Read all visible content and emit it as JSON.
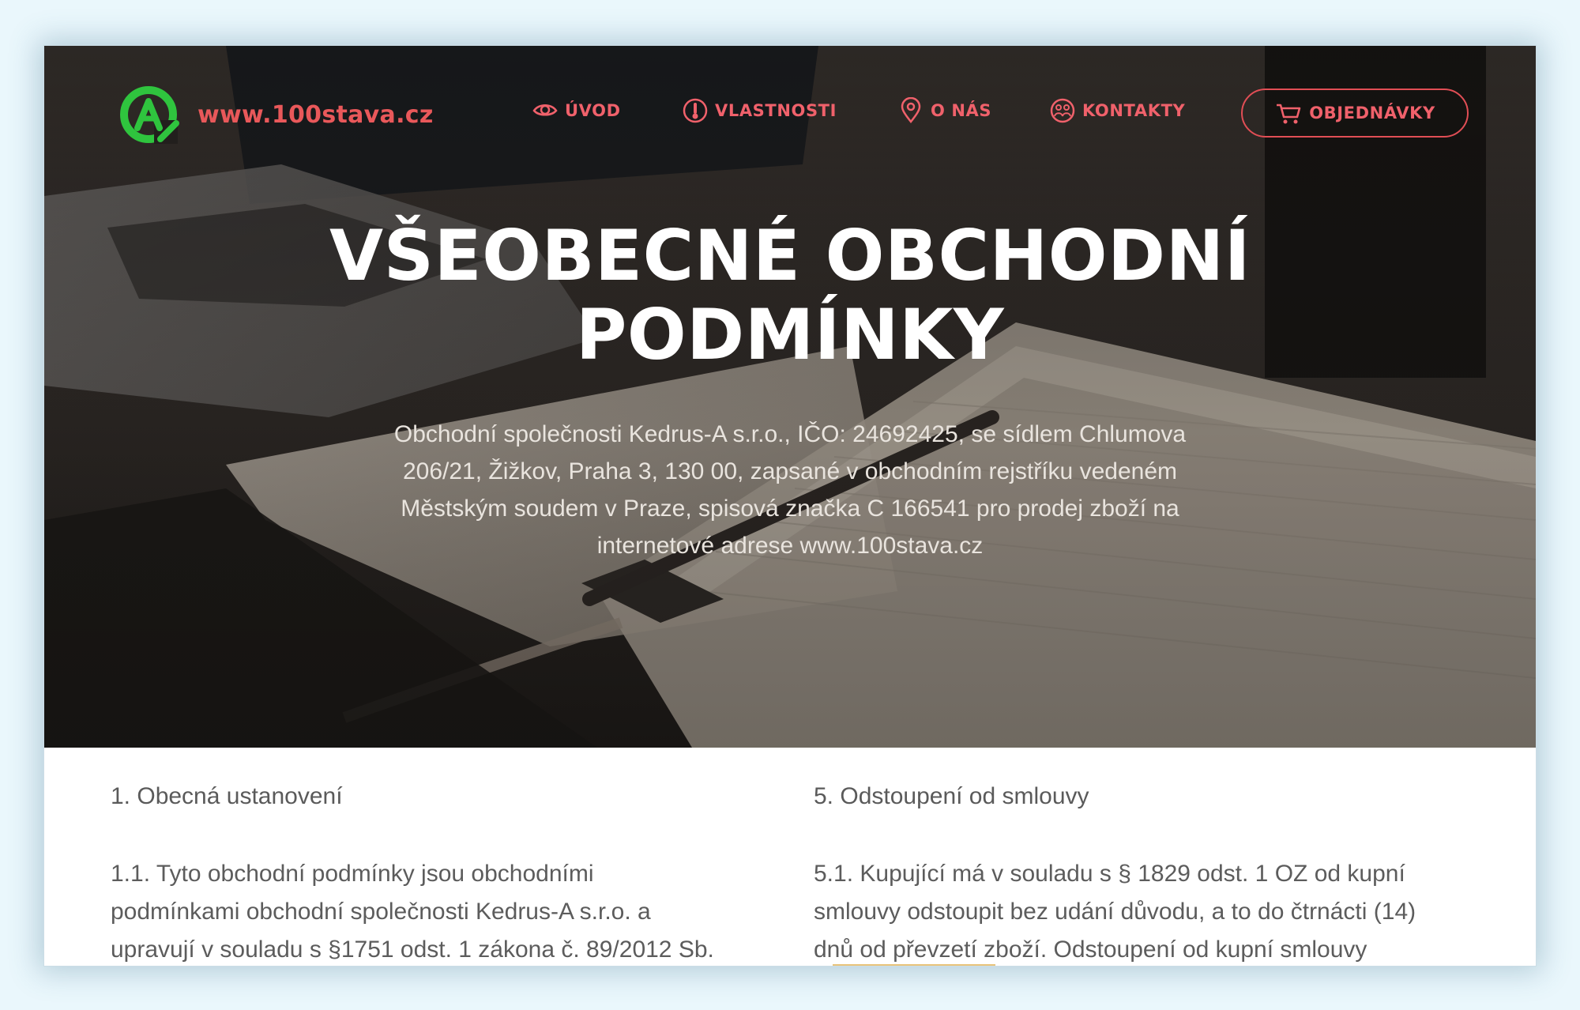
{
  "site": {
    "url_text": "www.100stava.cz"
  },
  "nav": {
    "items": [
      {
        "label": "ÚVOD",
        "icon": "eye-icon"
      },
      {
        "label": "VLASTNOSTI",
        "icon": "thermometer-icon"
      },
      {
        "label": "O NÁS",
        "icon": "location-pin-icon"
      },
      {
        "label": "KONTAKTY",
        "icon": "contacts-icon"
      }
    ],
    "order_button": {
      "label": "OBJEDNÁVKY",
      "icon": "cart-icon"
    }
  },
  "hero": {
    "title": "VŠEOBECNÉ OBCHODNÍ\nPODMÍNKY",
    "intro": "Obchodní společnosti Kedrus-A s.r.o., IČO: 24692425, se sídlem Chlumova\n206/21, Žižkov, Praha 3, 130 00, zapsané v obchodním rejstříku vedeném\nMěstským soudem v Praze, spisová značka C 166541  pro prodej zboží na\ninternetové adrese www.100stava.cz"
  },
  "terms": {
    "left": {
      "heading": "1. Obecná ustanovení",
      "paragraph": "1.1. Tyto obchodní podmínky jsou obchodními\npodmínkami obchodní společnosti Kedrus-A s.r.o. a\nupravují v souladu s §1751 odst. 1 zákona č. 89/2012 Sb."
    },
    "right": {
      "heading": "5. Odstoupení od smlouvy",
      "paragraph": "5.1. Kupující má v souladu s § 1829 odst. 1 OZ od kupní\nsmlouvy odstoupit bez udání důvodu, a to do čtrnácti (14)\ndnů od převzetí zboží. Odstoupení od kupní smlouvy"
    }
  },
  "colors": {
    "accent_red": "#f0616b",
    "logo_green": "#2fc43e",
    "hero_text": "#ffffff",
    "body_text": "#5c5c5c",
    "page_background": "#eaf7fc"
  }
}
